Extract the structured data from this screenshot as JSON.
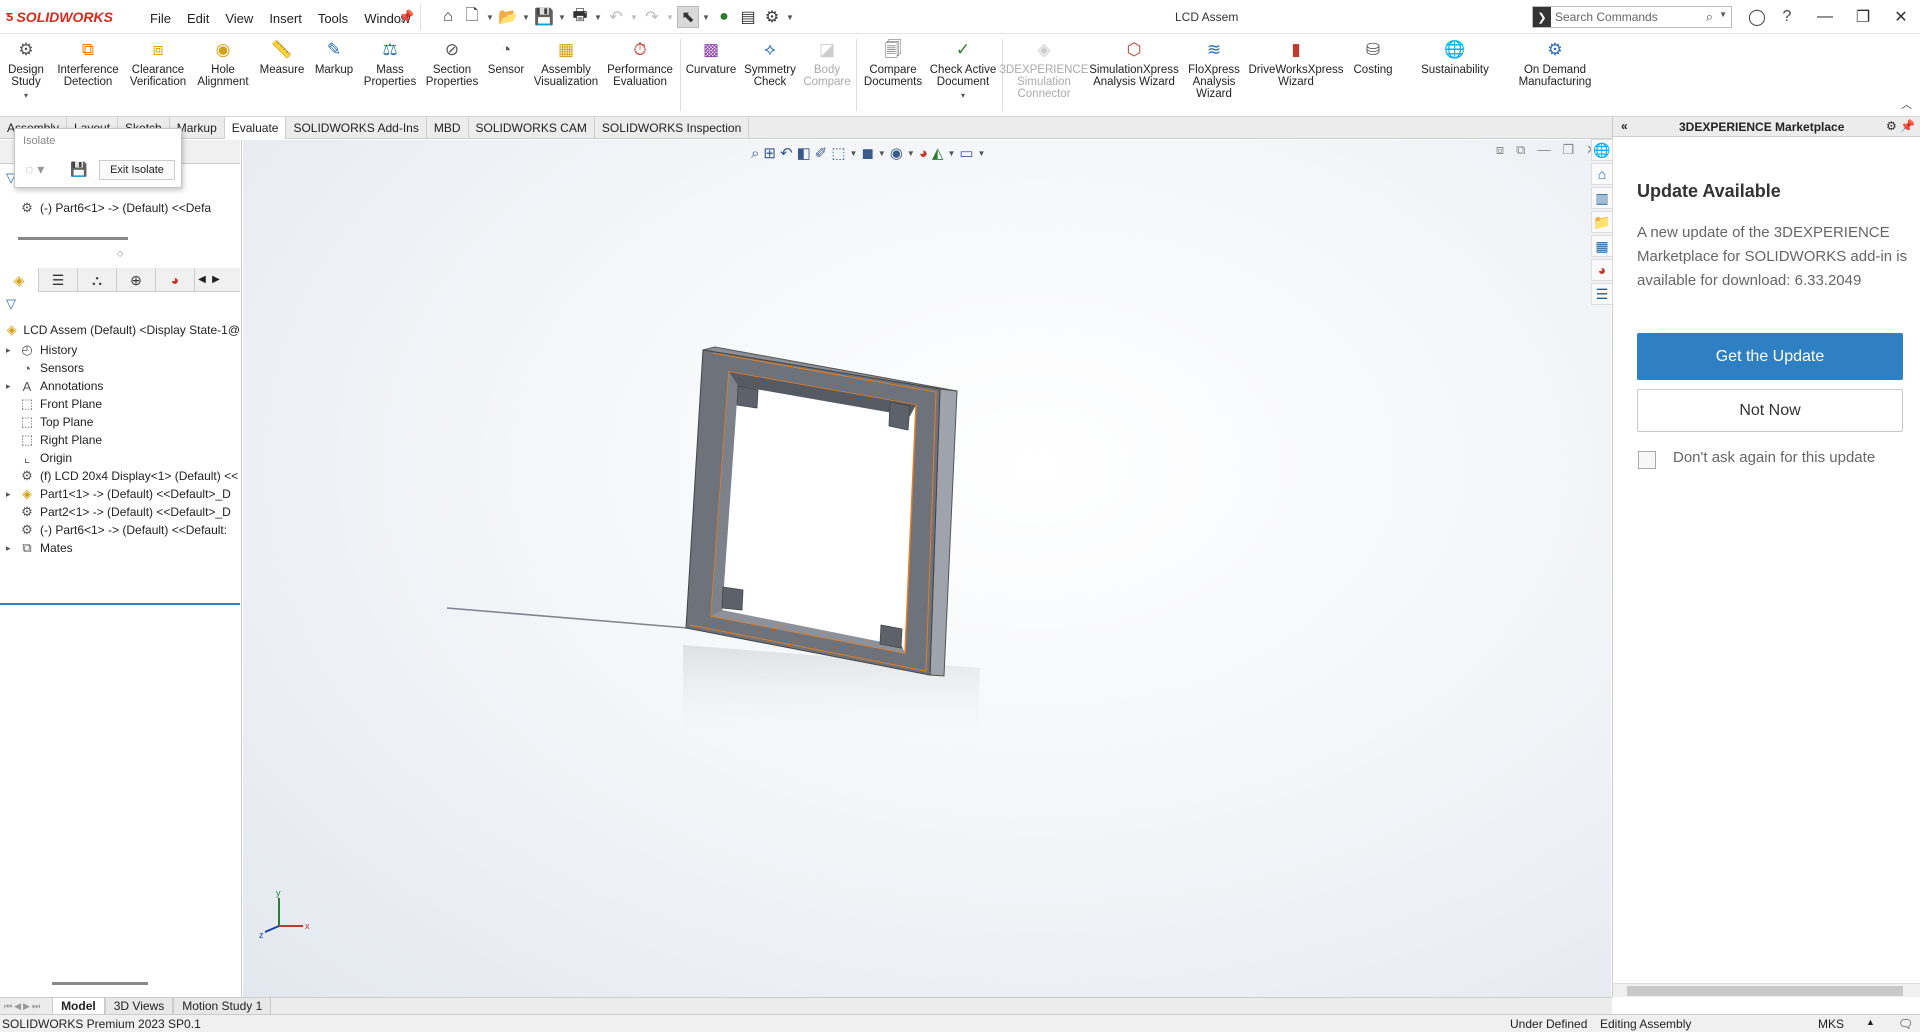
{
  "titlebar": {
    "brand": "SOLIDWORKS",
    "menu": [
      "File",
      "Edit",
      "View",
      "Insert",
      "Tools",
      "Window"
    ],
    "document_title": "LCD Assem",
    "search_placeholder": "Search Commands"
  },
  "ribbon": {
    "items": [
      {
        "label": "Design\nStudy",
        "icon": "design-study-icon"
      },
      {
        "label": "Interference\nDetection",
        "icon": "interference-icon"
      },
      {
        "label": "Clearance\nVerification",
        "icon": "clearance-icon"
      },
      {
        "label": "Hole\nAlignment",
        "icon": "hole-icon"
      },
      {
        "label": "Measure",
        "icon": "measure-icon"
      },
      {
        "label": "Markup",
        "icon": "markup-icon"
      },
      {
        "label": "Mass\nProperties",
        "icon": "mass-icon"
      },
      {
        "label": "Section\nProperties",
        "icon": "section-icon"
      },
      {
        "label": "Sensor",
        "icon": "sensor-icon"
      },
      {
        "label": "Assembly\nVisualization",
        "icon": "assembly-viz-icon"
      },
      {
        "label": "Performance\nEvaluation",
        "icon": "performance-icon"
      },
      {
        "label": "Curvature",
        "icon": "curvature-icon"
      },
      {
        "label": "Symmetry\nCheck",
        "icon": "symmetry-icon"
      },
      {
        "label": "Body\nCompare",
        "icon": "body-compare-icon"
      },
      {
        "label": "Compare\nDocuments",
        "icon": "compare-docs-icon"
      },
      {
        "label": "Check Active\nDocument",
        "icon": "check-doc-icon"
      },
      {
        "label": "3DEXPERIENCE\nSimulation\nConnector",
        "icon": "simulation-connector-icon"
      },
      {
        "label": "SimulationXpress\nAnalysis Wizard",
        "icon": "simxpress-icon"
      },
      {
        "label": "FloXpress\nAnalysis\nWizard",
        "icon": "floxpress-icon"
      },
      {
        "label": "DriveWorksXpress\nWizard",
        "icon": "driveworks-icon"
      },
      {
        "label": "Costing",
        "icon": "costing-icon"
      },
      {
        "label": "Sustainability",
        "icon": "sustainability-icon"
      },
      {
        "label": "On Demand\nManufacturing",
        "icon": "manufacturing-icon"
      }
    ]
  },
  "cmd_tabs": [
    "Assembly",
    "Layout",
    "Sketch",
    "Markup",
    "Evaluate",
    "SOLIDWORKS Add-Ins",
    "MBD",
    "SOLIDWORKS CAM",
    "SOLIDWORKS Inspection"
  ],
  "active_cmd_tab": "Evaluate",
  "isolate_popup": {
    "title": "Isolate",
    "exit_label": "Exit Isolate"
  },
  "upper_tree": {
    "row": "(-) Part6<1> -> (Default) <<Defa"
  },
  "feature_tree": {
    "root": "LCD Assem (Default) <Display State-1@",
    "items": [
      {
        "label": "History",
        "expandable": true,
        "icon": "history-icon"
      },
      {
        "label": "Sensors",
        "expandable": false,
        "icon": "sensors-icon"
      },
      {
        "label": "Annotations",
        "expandable": true,
        "icon": "annotations-icon"
      },
      {
        "label": "Front Plane",
        "expandable": false,
        "icon": "plane-icon"
      },
      {
        "label": "Top Plane",
        "expandable": false,
        "icon": "plane-icon"
      },
      {
        "label": "Right Plane",
        "expandable": false,
        "icon": "plane-icon"
      },
      {
        "label": "Origin",
        "expandable": false,
        "icon": "origin-icon"
      },
      {
        "label": "(f) LCD 20x4 Display<1> (Default) <<",
        "expandable": false,
        "icon": "part-icon"
      },
      {
        "label": "Part1<1> -> (Default) <<Default>_D",
        "expandable": true,
        "icon": "assembly-part-icon"
      },
      {
        "label": "Part2<1> -> (Default) <<Default>_D",
        "expandable": false,
        "icon": "part-icon"
      },
      {
        "label": "(-) Part6<1> -> (Default) <<Default:",
        "expandable": false,
        "icon": "part-icon"
      },
      {
        "label": "Mates",
        "expandable": true,
        "icon": "mates-icon"
      }
    ]
  },
  "task_pane": {
    "header": "3DEXPERIENCE Marketplace",
    "update_title": "Update Available",
    "update_text": "A new update of the 3DEXPERIENCE Marketplace for SOLIDWORKS add-in is available for download: 6.33.2049",
    "get_update_label": "Get the Update",
    "not_now_label": "Not Now",
    "dont_ask_label": "Don't ask again for this update"
  },
  "bottom_tabs": [
    "Model",
    "3D Views",
    "Motion Study 1"
  ],
  "active_bottom_tab": "Model",
  "status_bar": {
    "version": "SOLIDWORKS Premium 2023 SP0.1",
    "definition": "Under Defined",
    "mode": "Editing Assembly",
    "units": "MKS"
  },
  "triad": {
    "y": "y",
    "x": "x",
    "z": "z"
  },
  "colors": {
    "accent": "#2f80c2",
    "brand": "#d52b1e",
    "edge_highlight": "#e67e22"
  }
}
